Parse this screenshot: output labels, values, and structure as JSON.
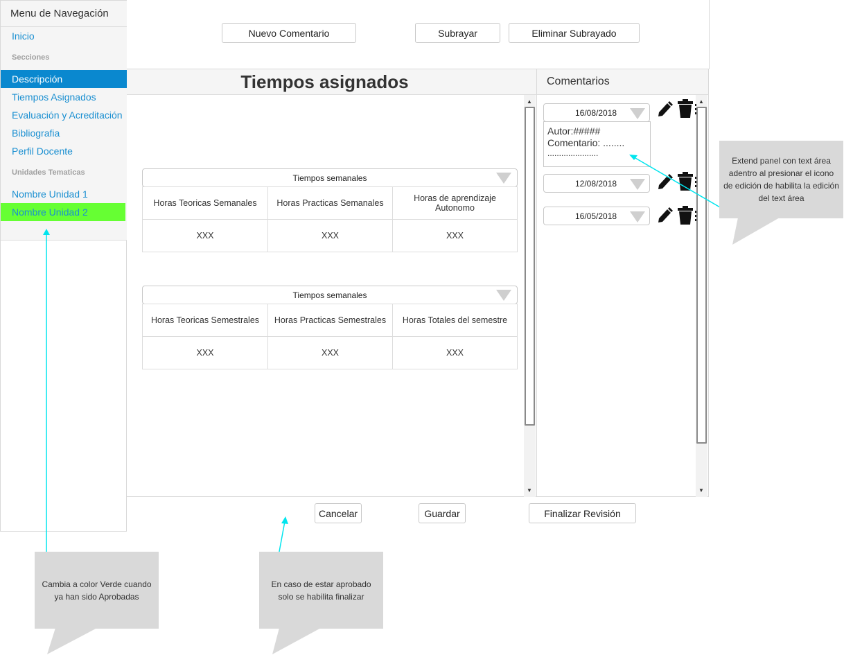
{
  "sidebar": {
    "title": "Menu de Navegación",
    "home": "Inicio",
    "sections_heading": "Secciones",
    "sections": [
      "Descripción",
      "Tiempos Asignados",
      "Evaluación y Acreditación",
      "Bibliografia",
      "Perfil Docente"
    ],
    "units_heading": "Unidades Tematicas",
    "units": [
      "Nombre Unidad 1",
      "Nombre Unidad 2"
    ]
  },
  "toolbar": {
    "new_comment": "Nuevo Comentario",
    "underline": "Subrayar",
    "remove_underline": "Eliminar Subrayado"
  },
  "main": {
    "title": "Tiempos asignados",
    "table1": {
      "header": "Tiempos semanales",
      "columns": [
        "Horas Teoricas Semanales",
        "Horas Practicas Semanales",
        "Horas de aprendizaje Autonomo"
      ],
      "values": [
        "XXX",
        "XXX",
        "XXX"
      ]
    },
    "table2": {
      "header": "Tiempos semanales",
      "columns": [
        "Horas Teoricas Semestrales",
        "Horas Practicas Semestrales",
        "Horas Totales del semestre"
      ],
      "values": [
        "XXX",
        "XXX",
        "XXX"
      ]
    }
  },
  "comments": {
    "title": "Comentarios",
    "items": [
      {
        "date": "16/08/2018",
        "author": "Autor:#####",
        "comment": "Comentario: ........",
        "dots": "......................"
      },
      {
        "date": "12/08/2018"
      },
      {
        "date": "16/05/2018"
      }
    ]
  },
  "footer": {
    "cancel": "Cancelar",
    "save": "Guardar",
    "finish": "Finalizar Revisión"
  },
  "callouts": {
    "extend": "Extend panel con text área adentro al presionar el icono de edición de habilita la edición del text área",
    "green": "Cambia a color Verde cuando ya han sido Aprobadas",
    "approved": "En caso de estar aprobado solo se habilita finalizar"
  },
  "colors": {
    "link": "#1a8fd1",
    "active": "#0a88cf",
    "approved": "#66ff33",
    "annotation": "#00e5ee"
  },
  "icons": [
    "pencil-icon",
    "trash-icon",
    "caret-down-icon",
    "scroll-up-icon",
    "scroll-down-icon"
  ]
}
